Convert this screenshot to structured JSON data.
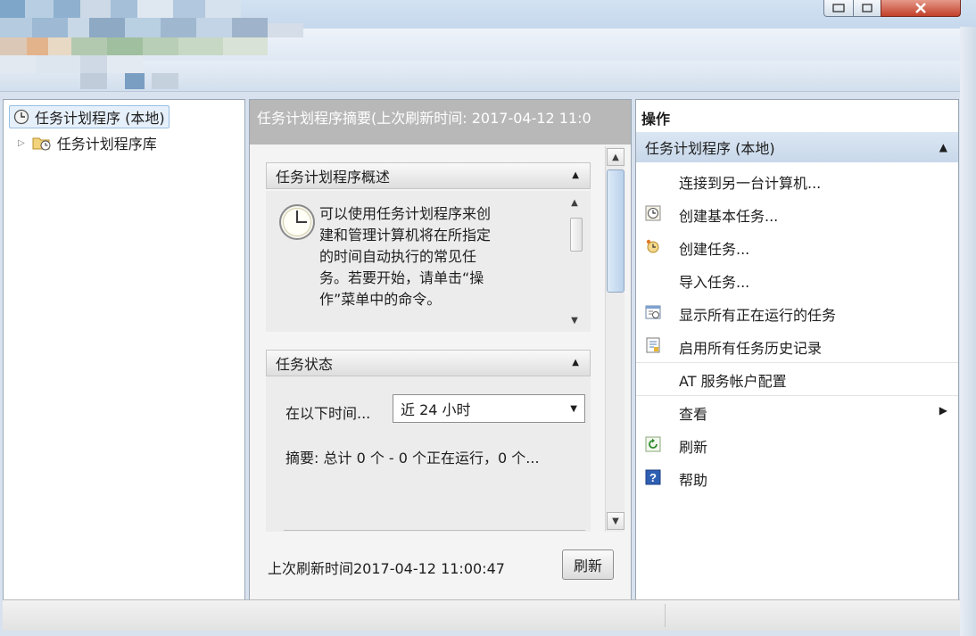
{
  "tree": {
    "root_label": "任务计划程序 (本地)",
    "library_label": "任务计划程序库"
  },
  "center": {
    "header": "任务计划程序摘要(上次刷新时间: 2017-04-12 11:0",
    "overview": {
      "title": "任务计划程序概述",
      "lines": [
        "可以使用任务计划程序来创",
        "建和管理计算机将在所指定",
        "的时间自动执行的常见任",
        "务。若要开始，请单击“操",
        "作”菜单中的命令。"
      ]
    },
    "status": {
      "title": "任务状态",
      "range_label": "在以下时间...",
      "range_value": "近 24 小时",
      "summary": "摘要: 总计 0 个 - 0 个正在运行，0 个..."
    },
    "footer": {
      "last_refresh": "上次刷新时间2017-04-12 11:00:47",
      "refresh_button": "刷新"
    }
  },
  "actions": {
    "title": "操作",
    "group": "任务计划程序 (本地)",
    "items": [
      {
        "label": "连接到另一台计算机...",
        "icon": "none"
      },
      {
        "label": "创建基本任务...",
        "icon": "basic-task-icon"
      },
      {
        "label": "创建任务...",
        "icon": "create-task-icon"
      },
      {
        "label": "导入任务...",
        "icon": "none"
      },
      {
        "label": "显示所有正在运行的任务",
        "icon": "running-tasks-icon"
      },
      {
        "label": "启用所有任务历史记录",
        "icon": "history-icon"
      },
      {
        "label": "AT 服务帐户配置",
        "icon": "none"
      },
      {
        "label": "查看",
        "icon": "none"
      },
      {
        "label": "刷新",
        "icon": "refresh-icon"
      },
      {
        "label": "帮助",
        "icon": "help-icon"
      }
    ]
  },
  "colors": {
    "accent": "#c8d8ea",
    "header_gray": "#b8b8b8",
    "help_blue": "#2f5fb3"
  }
}
